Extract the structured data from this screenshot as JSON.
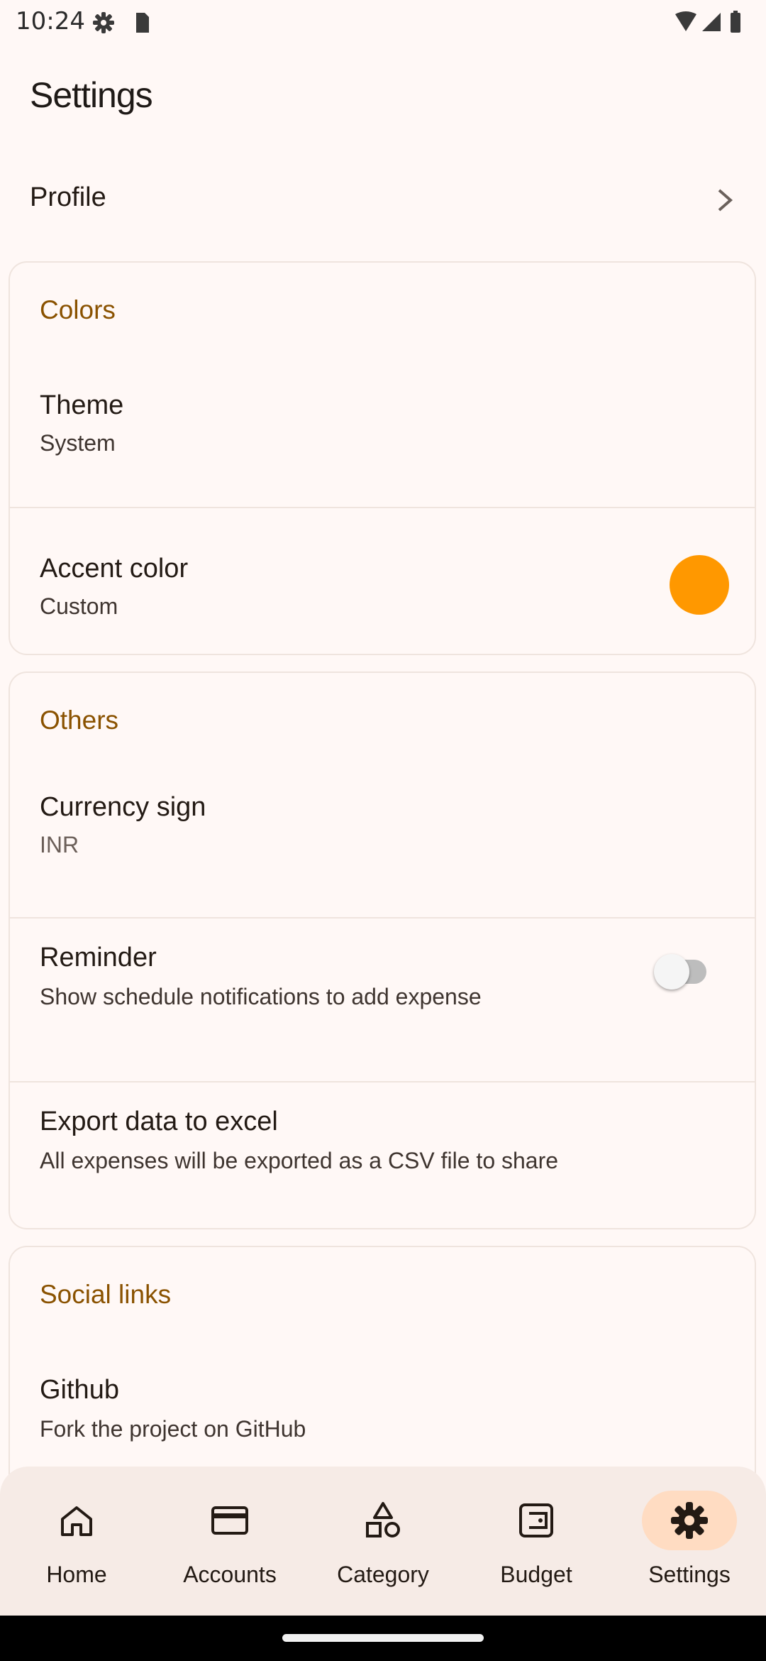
{
  "status_bar": {
    "time": "10:24"
  },
  "page": {
    "title": "Settings"
  },
  "profile": {
    "label": "Profile"
  },
  "colors_section": {
    "title": "Colors",
    "theme": {
      "title": "Theme",
      "value": "System"
    },
    "accent": {
      "title": "Accent color",
      "value": "Custom",
      "swatch_color": "#FF9800"
    }
  },
  "others_section": {
    "title": "Others",
    "currency": {
      "title": "Currency sign",
      "value": "INR"
    },
    "reminder": {
      "title": "Reminder",
      "subtitle": "Show schedule notifications to add expense",
      "enabled": false
    },
    "export": {
      "title": "Export data to excel",
      "subtitle": "All expenses will be exported as a CSV file to share"
    }
  },
  "social_section": {
    "title": "Social links",
    "github": {
      "title": "Github",
      "subtitle": "Fork the project on GitHub"
    }
  },
  "bottom_nav": {
    "items": [
      {
        "label": "Home",
        "icon": "home-icon"
      },
      {
        "label": "Accounts",
        "icon": "wallet-card-icon"
      },
      {
        "label": "Category",
        "icon": "category-shapes-icon"
      },
      {
        "label": "Budget",
        "icon": "budget-wallet-icon"
      },
      {
        "label": "Settings",
        "icon": "gear-icon",
        "active": true
      }
    ]
  },
  "colors": {
    "accent_text": "#8A5200",
    "active_pill": "#FFDCC2",
    "nav_background": "#F6EBE6"
  }
}
